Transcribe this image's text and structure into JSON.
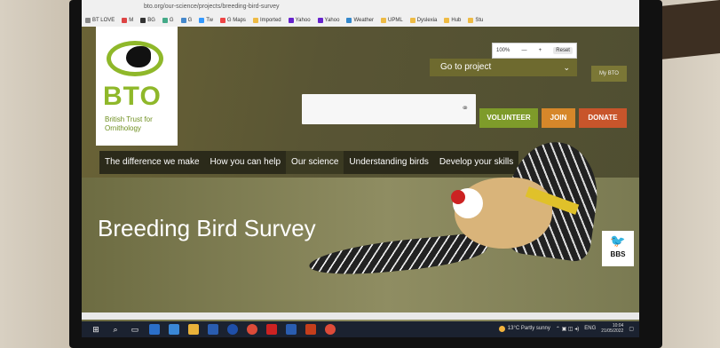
{
  "browser": {
    "url": "bto.org/our-science/projects/breeding-bird-survey",
    "bookmarks": [
      "BT LOVE",
      "M",
      "BG",
      "G",
      "G",
      "Tw",
      "G Maps",
      "Imported",
      "Yahoo",
      "Yahoo",
      "Weather",
      "UPML",
      "Dyslexia",
      "Hub",
      "Stu"
    ],
    "zoom_level": "100%",
    "zoom_minus": "—",
    "zoom_plus": "+",
    "zoom_reset": "Reset"
  },
  "logo": {
    "text": "BTO",
    "subtitle": "British Trust for Ornithology"
  },
  "header": {
    "go_to_project": "Go to project",
    "my_bto": "My BTO",
    "search_placeholder": ""
  },
  "buttons": {
    "volunteer": "VOLUNTEER",
    "join": "JOIN",
    "donate": "DONATE"
  },
  "nav": [
    {
      "label": "The difference we make"
    },
    {
      "label": "How you can help"
    },
    {
      "label": "Our science",
      "active": true
    },
    {
      "label": "Understanding birds"
    },
    {
      "label": "Develop your skills"
    }
  ],
  "hero": {
    "title": "Breeding Bird Survey",
    "badge": "BBS"
  },
  "taskbar": {
    "weather": "13°C Partly sunny",
    "lang": "ENG",
    "time": "10:04",
    "date": "21/05/2022"
  },
  "colors": {
    "bto_green": "#8fb82a",
    "volunteer": "#7e9b2a",
    "join": "#d6872a",
    "donate": "#c8552b"
  }
}
